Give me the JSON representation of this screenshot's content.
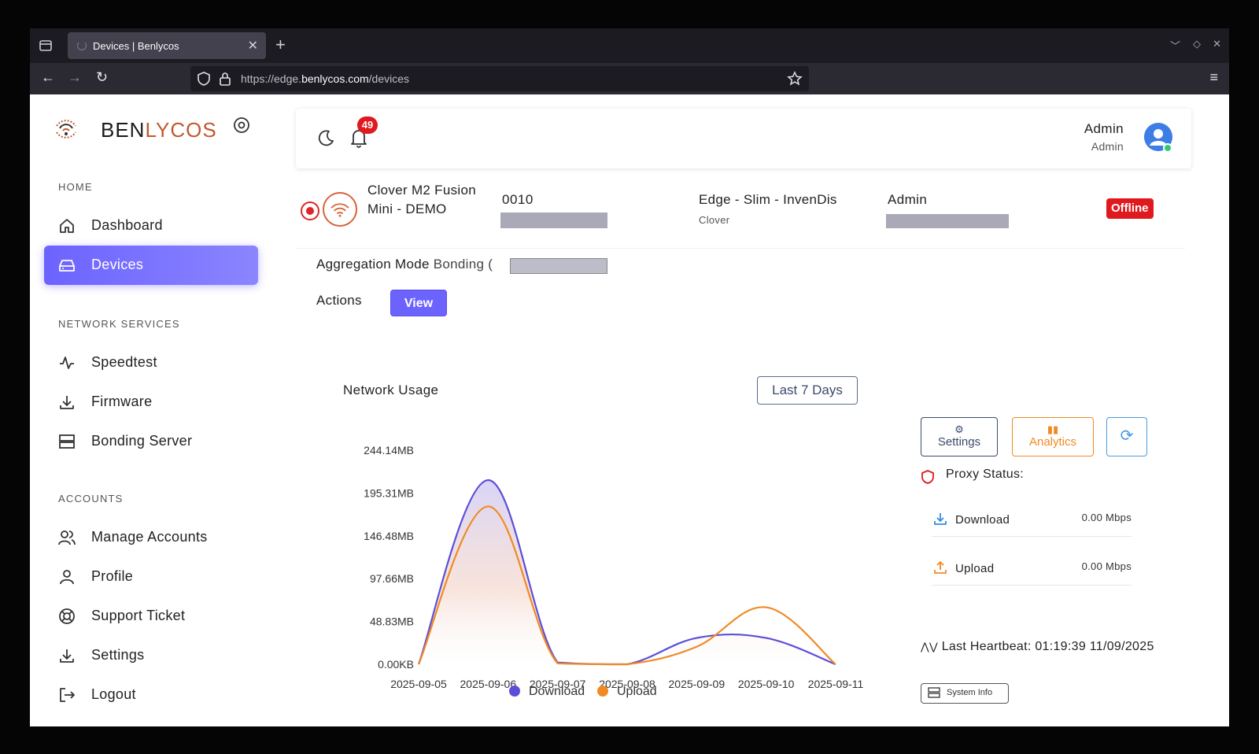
{
  "browser": {
    "tab_title": "Devices | Benlycos",
    "url_prefix": "https://edge.",
    "url_domain": "benlycos.com",
    "url_path": "/devices"
  },
  "sidebar": {
    "brand_a": "BEN",
    "brand_b": "LYCOS",
    "sections": {
      "home": "HOME",
      "network": "NETWORK SERVICES",
      "accounts": "ACCOUNTS"
    },
    "items": [
      {
        "label": "Dashboard",
        "icon": "home-icon"
      },
      {
        "label": "Devices",
        "icon": "devices-icon",
        "active": true
      },
      {
        "label": "Speedtest",
        "icon": "pulse-icon"
      },
      {
        "label": "Firmware",
        "icon": "download-icon"
      },
      {
        "label": "Bonding Server",
        "icon": "server-icon"
      },
      {
        "label": "Manage Accounts",
        "icon": "users-icon"
      },
      {
        "label": "Profile",
        "icon": "user-icon"
      },
      {
        "label": "Support Ticket",
        "icon": "lifebuoy-icon"
      },
      {
        "label": "Settings",
        "icon": "download-icon"
      },
      {
        "label": "Logout",
        "icon": "logout-icon"
      }
    ],
    "accent": "#6c63ff"
  },
  "header": {
    "notification_count": "49",
    "user_name": "Admin",
    "user_role": "Admin"
  },
  "device": {
    "name": "Clover M2 Fusion Mini - DEMO",
    "id": "0010",
    "model": "Edge - Slim - InvenDis",
    "brand": "Clover",
    "owner": "Admin",
    "status": "Offline",
    "status_color": "#e0191e"
  },
  "aggregation": {
    "label": "Aggregation Mode",
    "value": "Bonding ("
  },
  "actions": {
    "label": "Actions",
    "view_label": "View"
  },
  "usage": {
    "title": "Network Usage",
    "range_label": "Last 7 Days"
  },
  "chart_data": {
    "type": "area",
    "x": [
      "2025-09-05",
      "2025-09-06",
      "2025-09-07",
      "2025-09-08",
      "2025-09-09",
      "2025-09-10",
      "2025-09-11"
    ],
    "y_ticks": [
      "0.00KB",
      "48.83MB",
      "97.66MB",
      "146.48MB",
      "195.31MB",
      "244.14MB"
    ],
    "ylim": [
      0,
      244.14
    ],
    "yunit": "MB",
    "series": [
      {
        "name": "Download",
        "color": "#5b4fd9",
        "values": [
          0,
          210,
          2,
          0,
          30,
          30,
          0
        ]
      },
      {
        "name": "Upload",
        "color": "#f08a24",
        "values": [
          0,
          180,
          1,
          0,
          20,
          65,
          0
        ]
      }
    ],
    "legend": "bottom"
  },
  "panel": {
    "settings_label": "Settings",
    "analytics_label": "Analytics",
    "proxy_label": "Proxy Status:",
    "download_label": "Download",
    "download_value": "0.00 Mbps",
    "upload_label": "Upload",
    "upload_value": "0.00 Mbps",
    "heartbeat": "Last Heartbeat: 01:19:39 11/09/2025",
    "system_info_label": "System Info"
  }
}
